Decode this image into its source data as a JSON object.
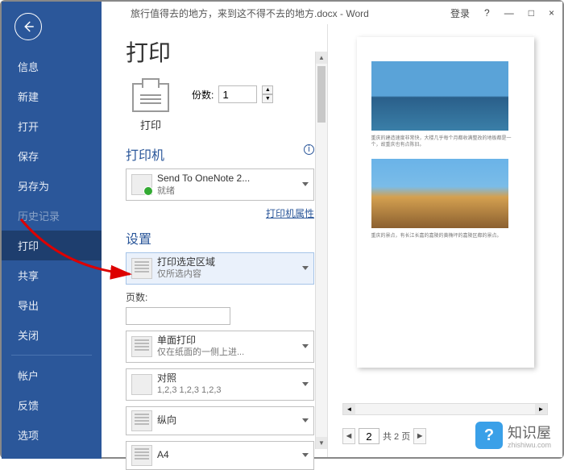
{
  "titlebar": {
    "doc": "旅行值得去的地方，来到这不得不去的地方.docx - Word",
    "login": "登录",
    "help": "?",
    "min": "—",
    "max": "□",
    "close": "×"
  },
  "sidebar": {
    "items": [
      {
        "label": "信息"
      },
      {
        "label": "新建"
      },
      {
        "label": "打开"
      },
      {
        "label": "保存"
      },
      {
        "label": "另存为"
      },
      {
        "label": "历史记录",
        "dim": true
      },
      {
        "label": "打印",
        "active": true
      },
      {
        "label": "共享"
      },
      {
        "label": "导出"
      },
      {
        "label": "关闭"
      }
    ],
    "bottom": [
      {
        "label": "帐户"
      },
      {
        "label": "反馈"
      },
      {
        "label": "选项"
      }
    ]
  },
  "main": {
    "title": "打印",
    "print_button": "打印",
    "copies_label": "份数:",
    "copies_value": "1",
    "printer": {
      "section": "打印机",
      "name": "Send To OneNote 2...",
      "status": "就绪",
      "props_link": "打印机属性"
    },
    "settings": {
      "section": "设置",
      "scope": {
        "title": "打印选定区域",
        "sub": "仅所选内容"
      },
      "pages_label": "页数:",
      "duplex": {
        "title": "单面打印",
        "sub": "仅在纸面的一侧上进..."
      },
      "collate": {
        "title": "对照",
        "sub": "1,2,3   1,2,3   1,2,3"
      },
      "orient": {
        "title": "纵向"
      },
      "paper": {
        "title": "A4"
      }
    }
  },
  "preview": {
    "caption1": "重庆的建造速度非常快，大楼几乎每个月都收满整改的地板都是一个，故重庆也有点陈旧。",
    "caption2": "重庆的景点，有长江长嘉的嘉陵的黄桷坪的嘉陵区都的景点。"
  },
  "pager": {
    "prev": "◄",
    "page": "2",
    "total": "共 2 页",
    "next": "►"
  },
  "watermark": {
    "brand": "知识屋",
    "url": "zhishiwu.com"
  }
}
